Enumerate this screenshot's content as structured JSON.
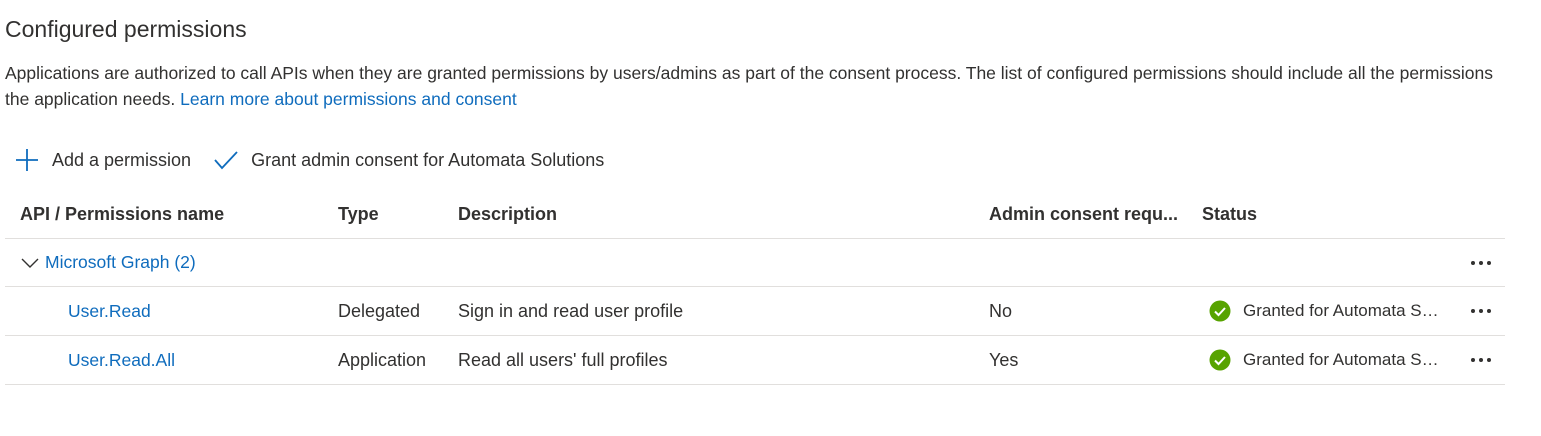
{
  "section": {
    "title": "Configured permissions",
    "description_text": "Applications are authorized to call APIs when they are granted permissions by users/admins as part of the consent process. The list of configured permissions should include all the permissions the application needs.",
    "learn_more_link": "Learn more about permissions and consent"
  },
  "toolbar": {
    "add_label": "Add a permission",
    "grant_label": "Grant admin consent for Automata Solutions"
  },
  "table": {
    "columns": {
      "name": "API / Permissions name",
      "type": "Type",
      "description": "Description",
      "admin_consent": "Admin consent requ...",
      "status": "Status"
    },
    "group": {
      "label": "Microsoft Graph (2)"
    },
    "rows": [
      {
        "name": "User.Read",
        "type": "Delegated",
        "description": "Sign in and read user profile",
        "admin_consent": "No",
        "status": "Granted for Automata Solutions"
      },
      {
        "name": "User.Read.All",
        "type": "Application",
        "description": "Read all users' full profiles",
        "admin_consent": "Yes",
        "status": "Granted for Automata Solutions"
      }
    ]
  },
  "colors": {
    "accent": "#0f6cbd",
    "success": "#57a300",
    "text": "#323130",
    "divider": "#e1dfdd"
  },
  "icons": {
    "add": "plus-icon",
    "grant": "checkmark-icon",
    "expand": "chevron-down-icon",
    "status": "check-circle-icon",
    "more": "more-horizontal-icon"
  }
}
